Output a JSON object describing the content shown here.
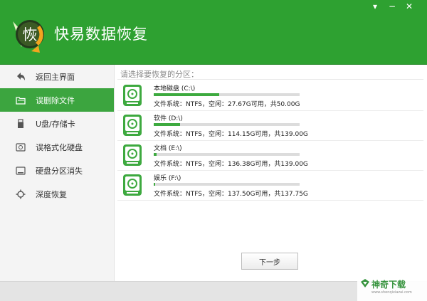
{
  "app": {
    "title": "快易数据恢复",
    "logo_text": "恢"
  },
  "window": {
    "minimize": "▾",
    "restore": "−",
    "close": "✕"
  },
  "sidebar": {
    "items": [
      {
        "label": "返回主界面",
        "icon": "back-arrow-icon"
      },
      {
        "label": "误删除文件",
        "icon": "folder-icon",
        "active": true
      },
      {
        "label": "U盘/存储卡",
        "icon": "usb-drive-icon"
      },
      {
        "label": "误格式化硬盘",
        "icon": "hard-disk-icon"
      },
      {
        "label": "硬盘分区消失",
        "icon": "partition-icon"
      },
      {
        "label": "深度恢复",
        "icon": "deep-scan-icon"
      }
    ]
  },
  "main": {
    "prompt": "请选择要恢复的分区：",
    "disks": [
      {
        "name": "本地磁盘 (C:\\)",
        "info": "文件系统：NTFS，空闲：27.67G可用，共50.00G",
        "used_fraction": 0.45
      },
      {
        "name": "软件 (D:\\)",
        "info": "文件系统：NTFS，空闲：114.15G可用，共139.00G",
        "used_fraction": 0.18
      },
      {
        "name": "文档 (E:\\)",
        "info": "文件系统：NTFS，空闲：136.38G可用，共139.00G",
        "used_fraction": 0.02
      },
      {
        "name": "娱乐 (F:\\)",
        "info": "文件系统：NTFS，空闲：137.50G可用，共137.75G",
        "used_fraction": 0.005
      }
    ],
    "next_label": "下一步"
  },
  "watermark": {
    "text": "神奇下载",
    "sub": "www.shenqixiazai.com"
  },
  "colors": {
    "brand_green": "#2ea131",
    "active_green": "#3ca53f",
    "bar_fill": "#3daa3f"
  }
}
